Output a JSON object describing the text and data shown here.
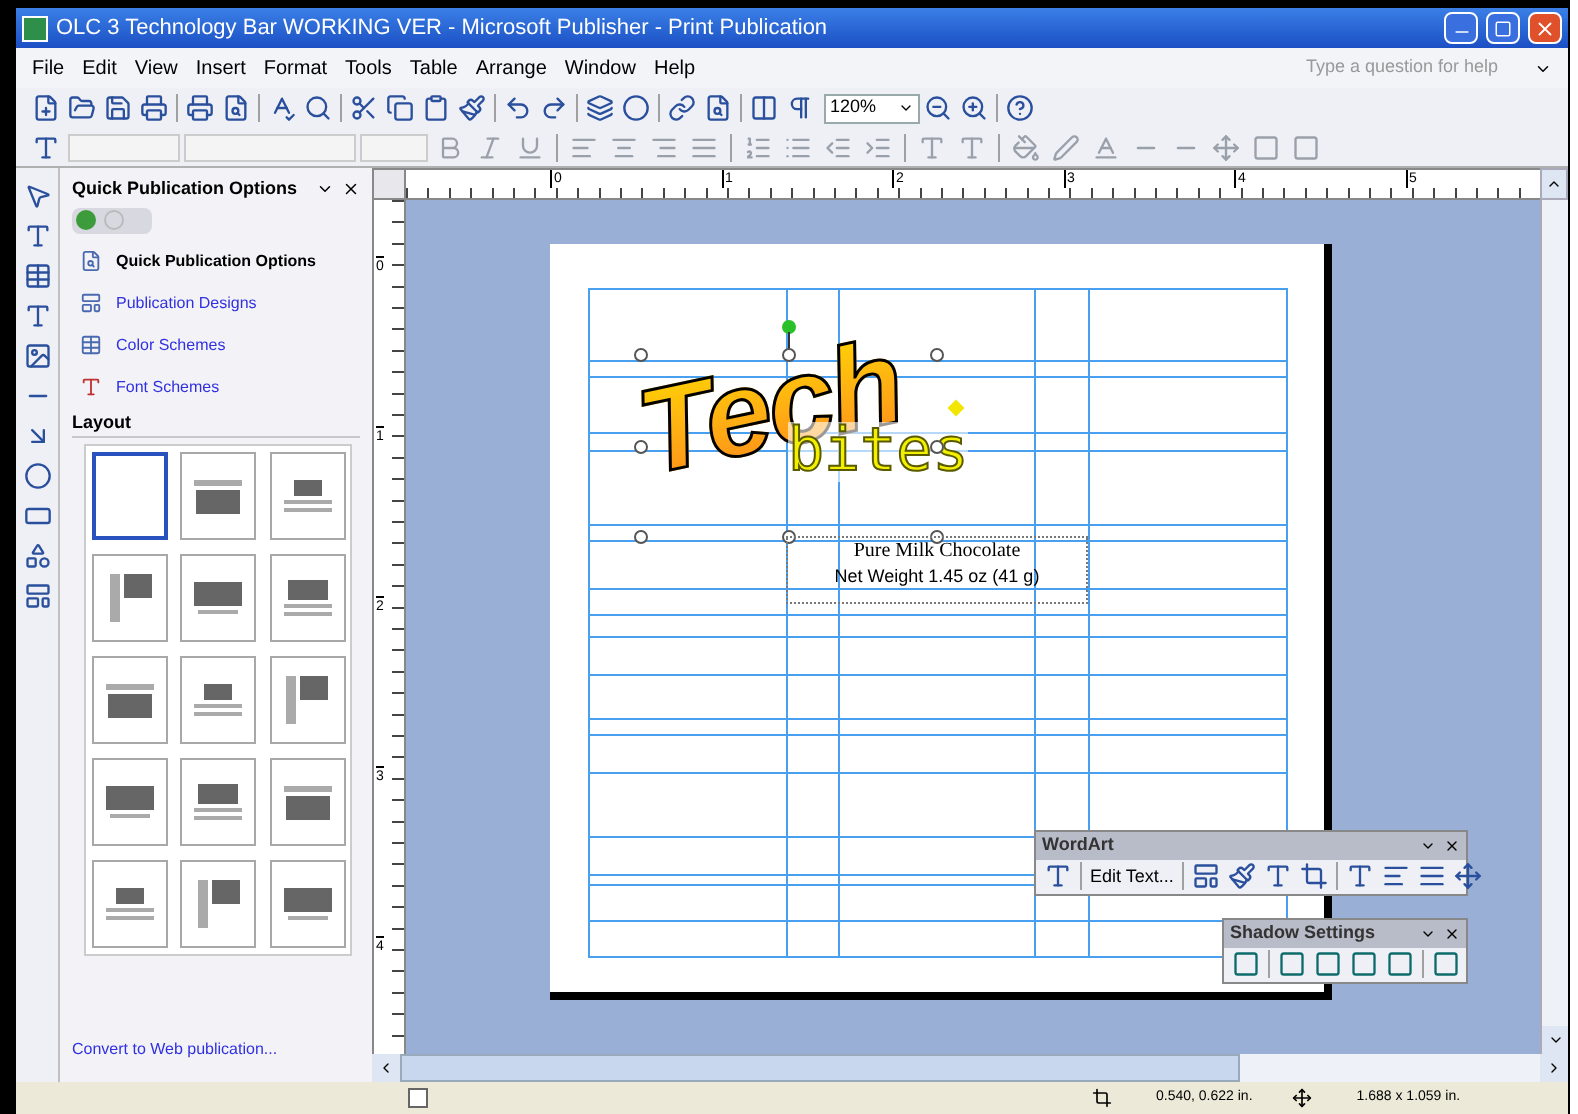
{
  "window": {
    "title": "OLC 3 Technology Bar WORKING VER - Microsoft Publisher - Print Publication"
  },
  "menus": [
    "File",
    "Edit",
    "View",
    "Insert",
    "Format",
    "Tools",
    "Table",
    "Arrange",
    "Window",
    "Help"
  ],
  "help_box": {
    "placeholder": "Type a question for help"
  },
  "zoom": "120%",
  "task_pane": {
    "title": "Quick Publication Options",
    "items": [
      {
        "kind": "heading",
        "label": "Quick Publication Options"
      },
      {
        "kind": "link",
        "label": "Publication Designs"
      },
      {
        "kind": "link",
        "label": "Color Schemes"
      },
      {
        "kind": "link",
        "label": "Font Schemes"
      }
    ],
    "layout_label": "Layout",
    "layouts": [
      {
        "selected": true
      },
      {
        "selected": false
      },
      {
        "selected": false
      },
      {
        "selected": false
      },
      {
        "selected": false
      },
      {
        "selected": false
      },
      {
        "selected": false
      },
      {
        "selected": false
      },
      {
        "selected": false
      },
      {
        "selected": false
      },
      {
        "selected": false
      },
      {
        "selected": false
      },
      {
        "selected": false
      },
      {
        "selected": false
      },
      {
        "selected": false
      }
    ],
    "footer_link": "Convert to Web publication..."
  },
  "rulers": {
    "horizontal": [
      "0",
      "1",
      "2",
      "3",
      "4",
      "5"
    ],
    "vertical": [
      "0",
      "1",
      "2",
      "3",
      "4"
    ]
  },
  "wordart": {
    "main": "Tech",
    "accent": "bites"
  },
  "text_box": {
    "lines": [
      "Pure Milk Chocolate",
      "Net Weight 1.45 oz (41 g)"
    ]
  },
  "wordart_toolbar": {
    "title": "WordArt",
    "edit_button": "Edit Text..."
  },
  "shadow_toolbar": {
    "title": "Shadow Settings"
  },
  "status_bar": {
    "position": "0.540, 0.622 in.",
    "size": "1.688 x 1.059 in."
  }
}
